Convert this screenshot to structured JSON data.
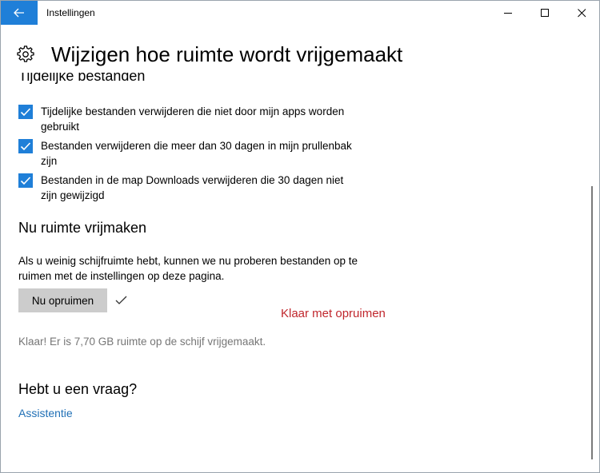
{
  "window": {
    "title": "Instellingen"
  },
  "page": {
    "title": "Wijzigen hoe ruimte wordt vrijgemaakt"
  },
  "temp_files": {
    "heading": "Tijdelijke bestanden",
    "options": [
      {
        "label": "Tijdelijke bestanden verwijderen die niet door mijn apps worden gebruikt",
        "checked": true
      },
      {
        "label": "Bestanden verwijderen die meer dan 30 dagen in mijn prullenbak zijn",
        "checked": true
      },
      {
        "label": "Bestanden in de map Downloads verwijderen die 30 dagen niet zijn gewijzigd",
        "checked": true
      }
    ]
  },
  "free_now": {
    "heading": "Nu ruimte vrijmaken",
    "description": "Als u weinig schijfruimte hebt, kunnen we nu proberen bestanden op te ruimen met de instellingen op deze pagina.",
    "button_label": "Nu opruimen",
    "annotation": "Klaar met opruimen",
    "status": "Klaar! Er is 7,70 GB ruimte op de schijf vrijgemaakt."
  },
  "help": {
    "heading": "Hebt u een vraag?",
    "link": "Assistentie"
  },
  "colors": {
    "accent": "#1f7fd8",
    "annotation": "#c0272d",
    "link": "#1f6fb5",
    "status_text": "#767676",
    "button_bg": "#cccccc"
  },
  "icons": {
    "back": "arrow-left-icon",
    "minimize": "minimize-icon",
    "maximize": "maximize-icon",
    "close": "close-icon",
    "settings": "gear-icon",
    "checkbox": "checkmark-icon",
    "done": "checkmark-icon"
  }
}
